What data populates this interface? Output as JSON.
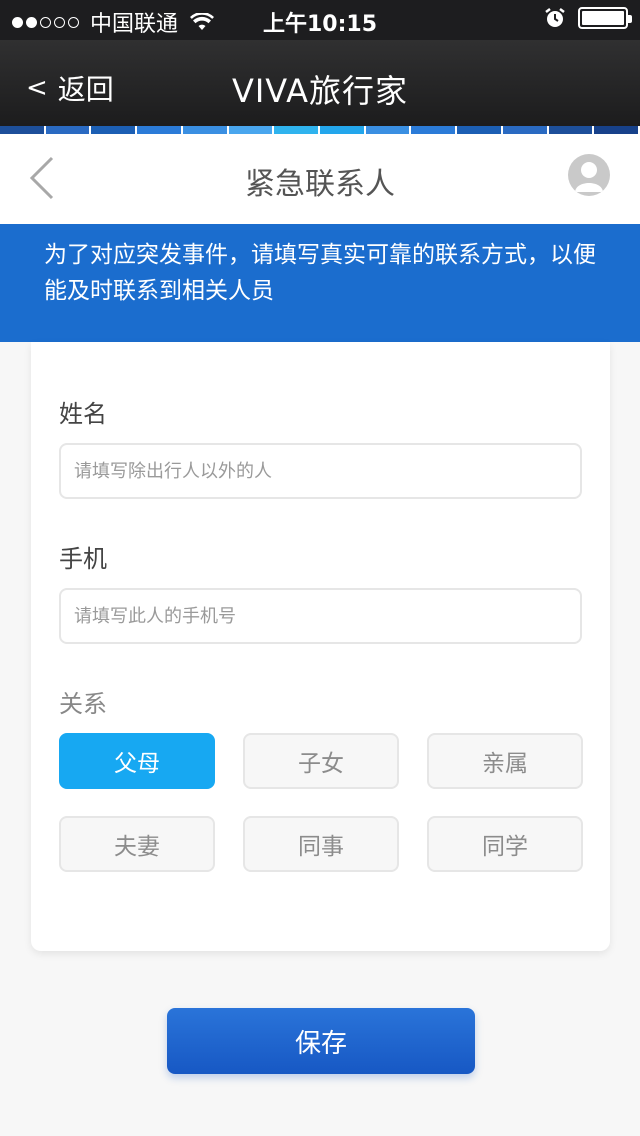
{
  "status_bar": {
    "carrier": "中国联通",
    "time": "上午10:15",
    "signal_bars_filled": 2,
    "signal_bars_total": 5,
    "battery_level": 1.0
  },
  "nav": {
    "back_label": "返回",
    "back_chevron": "<",
    "app_title": "VIVA旅行家"
  },
  "stripe_colors": [
    "#1d4f9a",
    "#2a6ac2",
    "#1c5fb4",
    "#2b7bd8",
    "#3a8fe2",
    "#49a6ee",
    "#2fb3ee",
    "#23a6ec",
    "#3a8fe2",
    "#2b7bd8",
    "#1c5fb4",
    "#2a6ac2",
    "#1d4f9a",
    "#17418a"
  ],
  "header": {
    "title": "紧急联系人",
    "back_icon": "chevron-left-icon",
    "avatar_icon": "user-avatar-icon"
  },
  "notice": {
    "text": "为了对应突发事件，请填写真实可靠的联系方式，以便能及时联系到相关人员"
  },
  "form": {
    "name_label": "姓名",
    "name_value": "",
    "name_placeholder": "请填写除出行人以外的人",
    "phone_label": "手机",
    "phone_value": "",
    "phone_placeholder": "请填写此人的手机号",
    "relation_label": "关系",
    "relations": [
      "父母",
      "子女",
      "亲属",
      "夫妻",
      "同事",
      "同学"
    ],
    "selected_relation": "父母"
  },
  "actions": {
    "save_label": "保存"
  },
  "colors": {
    "accent_blue": "#1b6dce",
    "selected_blue": "#17a8f2",
    "save_button": "#1f66d0"
  }
}
